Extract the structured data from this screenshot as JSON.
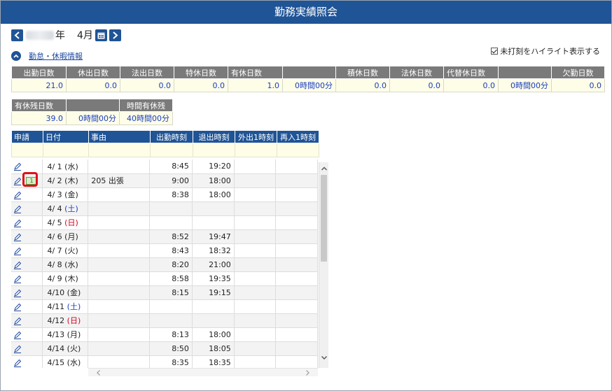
{
  "window": {
    "title": "勤務実績照会"
  },
  "nav": {
    "year_suffix": "年",
    "month": "4月"
  },
  "highlight_toggle": {
    "label": "未打刻をハイライト表示する",
    "checked": true
  },
  "section": {
    "label": "勤怠・休暇情報"
  },
  "summary1": {
    "headers": [
      "出勤日数",
      "休出日数",
      "法出日数",
      "特休日数",
      "有休日数",
      "",
      "積休日数",
      "法休日数",
      "代替休日数",
      "",
      "欠勤日数"
    ],
    "values": [
      "21.0",
      "0.0",
      "0.0",
      "0.0",
      "1.0",
      "0時間00分",
      "0.0",
      "0.0",
      "0.0",
      "0時間00分",
      "0.0"
    ]
  },
  "summary2": {
    "headers": [
      "有休残日数",
      "",
      "時間有休残"
    ],
    "values": [
      "39.0",
      "0時間00分",
      "40時間00分"
    ]
  },
  "grid": {
    "headers": {
      "apply": "申請",
      "date": "日付",
      "reason": "事由",
      "in": "出勤時刻",
      "out": "退出時刻",
      "go_out": "外出1時刻",
      "re_enter": "再入1時刻"
    },
    "badge_label": "1",
    "rows": [
      {
        "date": "4/ 1",
        "dow": "(水)",
        "dow_type": "weekday",
        "reason": "",
        "in": "8:45",
        "out": "19:20",
        "shade": false,
        "badge": false
      },
      {
        "date": "4/ 2",
        "dow": "(木)",
        "dow_type": "weekday",
        "reason": "205 出張",
        "in": "9:00",
        "out": "18:00",
        "shade": true,
        "badge": true
      },
      {
        "date": "4/ 3",
        "dow": "(金)",
        "dow_type": "weekday",
        "reason": "",
        "in": "8:38",
        "out": "18:00",
        "shade": false,
        "badge": false
      },
      {
        "date": "4/ 4",
        "dow": "(土)",
        "dow_type": "sat",
        "reason": "",
        "in": "",
        "out": "",
        "shade": true,
        "badge": false
      },
      {
        "date": "4/ 5",
        "dow": "(日)",
        "dow_type": "sun",
        "reason": "",
        "in": "",
        "out": "",
        "shade": false,
        "badge": false
      },
      {
        "date": "4/ 6",
        "dow": "(月)",
        "dow_type": "weekday",
        "reason": "",
        "in": "8:52",
        "out": "19:47",
        "shade": true,
        "badge": false
      },
      {
        "date": "4/ 7",
        "dow": "(火)",
        "dow_type": "weekday",
        "reason": "",
        "in": "8:43",
        "out": "18:32",
        "shade": false,
        "badge": false
      },
      {
        "date": "4/ 8",
        "dow": "(水)",
        "dow_type": "weekday",
        "reason": "",
        "in": "8:20",
        "out": "21:00",
        "shade": true,
        "badge": false
      },
      {
        "date": "4/ 9",
        "dow": "(木)",
        "dow_type": "weekday",
        "reason": "",
        "in": "8:58",
        "out": "19:35",
        "shade": false,
        "badge": false
      },
      {
        "date": "4/10",
        "dow": "(金)",
        "dow_type": "weekday",
        "reason": "",
        "in": "8:15",
        "out": "19:15",
        "shade": true,
        "badge": false
      },
      {
        "date": "4/11",
        "dow": "(土)",
        "dow_type": "sat",
        "reason": "",
        "in": "",
        "out": "",
        "shade": false,
        "badge": false
      },
      {
        "date": "4/12",
        "dow": "(日)",
        "dow_type": "sun",
        "reason": "",
        "in": "",
        "out": "",
        "shade": true,
        "badge": false
      },
      {
        "date": "4/13",
        "dow": "(月)",
        "dow_type": "weekday",
        "reason": "",
        "in": "8:13",
        "out": "18:00",
        "shade": false,
        "badge": false
      },
      {
        "date": "4/14",
        "dow": "(火)",
        "dow_type": "weekday",
        "reason": "",
        "in": "8:50",
        "out": "18:05",
        "shade": true,
        "badge": false
      },
      {
        "date": "4/15",
        "dow": "(水)",
        "dow_type": "weekday",
        "reason": "",
        "in": "8:35",
        "out": "18:35",
        "shade": false,
        "badge": false
      }
    ]
  }
}
